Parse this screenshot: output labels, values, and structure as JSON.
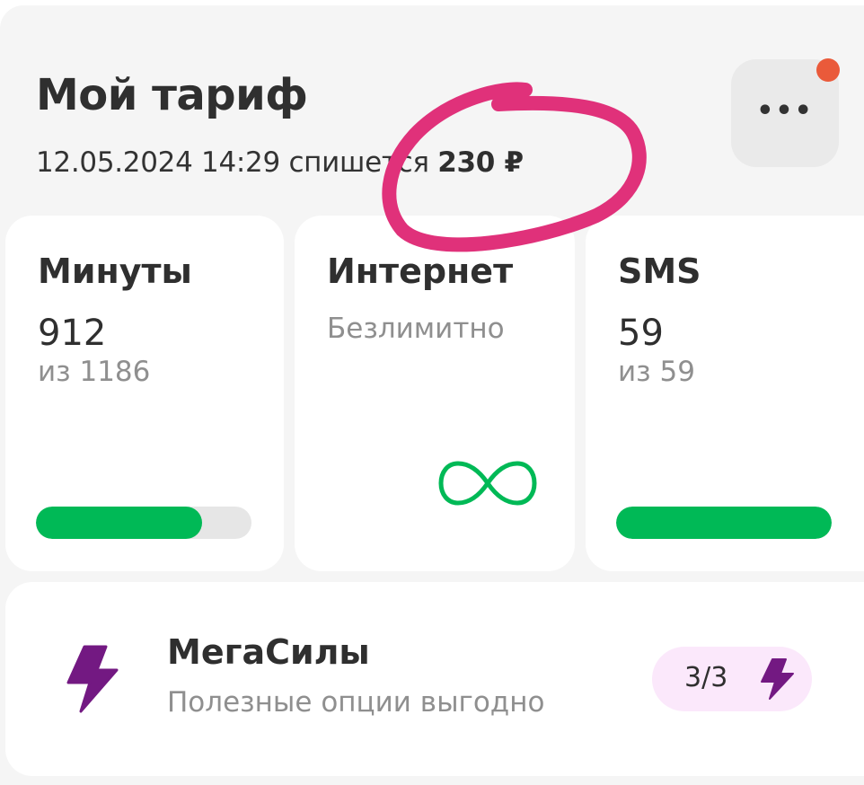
{
  "tariff": {
    "title": "Мой тариф",
    "charge_prefix": "12.05.2024 14:29 спишется",
    "charge_amount": "230 ₽",
    "more_label": "•••"
  },
  "cards": {
    "minutes": {
      "title": "Минуты",
      "value": "912",
      "sub": "из 1186",
      "progress": 0.769
    },
    "internet": {
      "title": "Интернет",
      "sub": "Безлимитно",
      "icon": "infinity-icon"
    },
    "sms": {
      "title": "SMS",
      "value": "59",
      "sub": "из 59",
      "progress": 1.0
    }
  },
  "megasily": {
    "title": "МегаСилы",
    "subtitle": "Полезные опции выгодно",
    "badge": "3/3",
    "icon": "lightning-icon"
  },
  "colors": {
    "accent_green": "#00b956",
    "bolt_purple": "#731982",
    "notification": "#ea5a3a",
    "annotation": "#e0317a",
    "badge_bg": "#fbe8fb"
  }
}
